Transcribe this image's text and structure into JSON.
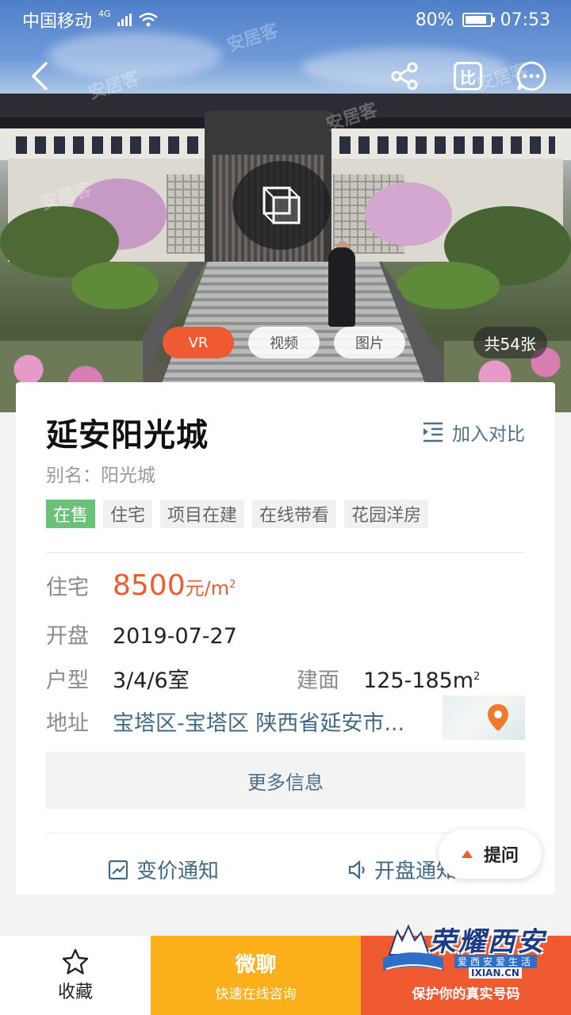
{
  "status_bar": {
    "carrier": "中国移动",
    "network": "4G",
    "battery": "80%",
    "time": "07:53"
  },
  "hero": {
    "watermark": "安居客",
    "media_tabs": [
      "VR",
      "视频",
      "图片"
    ],
    "photo_count": "共54张"
  },
  "property": {
    "name": "延安阳光城",
    "add_compare": "加入对比",
    "alias": "别名：阳光城",
    "tags": [
      "在售",
      "住宅",
      "项目在建",
      "在线带看",
      "花园洋房"
    ]
  },
  "info": {
    "price_label": "住宅",
    "price_value": "8500",
    "price_unit": "元/m",
    "open_label": "开盘",
    "open_value": "2019-07-27",
    "layout_label": "户型",
    "layout_value": "3/4/6室",
    "area_label": "建面",
    "area_value": "125-185m",
    "address_label": "地址",
    "address_value": "宝塔区-宝塔区 陕西省延安市..."
  },
  "more_info": "更多信息",
  "notify": {
    "price_change": "变价通知",
    "opening": "开盘通知"
  },
  "ask": "提问",
  "bottom_bar": {
    "favorite": "收藏",
    "wechat_title": "微聊",
    "wechat_sub": "快速在线咨询",
    "call_sub": "保护你的真实号码"
  },
  "logo": {
    "title": "荣耀西安",
    "subtitle": "爱西安爱生活",
    "url": "IXIAN.CN"
  },
  "colors": {
    "accent": "#ef5a32",
    "on_sale": "#6bc07a",
    "link": "#3f6a86",
    "wechat": "#fbb01b",
    "call": "#f05a30"
  }
}
